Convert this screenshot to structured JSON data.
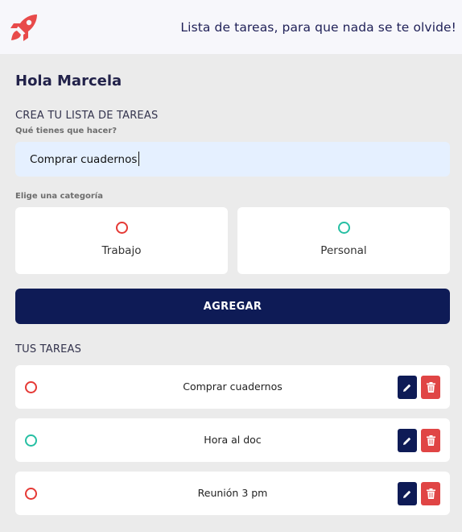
{
  "header": {
    "logo_icon": "rocket-icon",
    "tagline": "Lista de tareas, para que nada se te olvide!"
  },
  "greeting": "Hola Marcela",
  "create": {
    "section_title": "CREA TU LISTA DE TAREAS",
    "input_label": "Qué tienes que hacer?",
    "input_value": "Comprar cuadernos",
    "category_label": "Elige una categoría",
    "categories": [
      {
        "label": "Trabajo",
        "color": "#e53935"
      },
      {
        "label": "Personal",
        "color": "#26bfa3"
      }
    ],
    "add_button": "AGREGAR"
  },
  "tasks": {
    "section_title": "TUS TAREAS",
    "items": [
      {
        "text": "Comprar cuadernos",
        "category": "Trabajo",
        "color": "#e53935"
      },
      {
        "text": "Hora al doc",
        "category": "Personal",
        "color": "#26bfa3"
      },
      {
        "text": "Reunión 3 pm",
        "category": "Trabajo",
        "color": "#e53935"
      }
    ],
    "edit_icon": "pencil-icon",
    "delete_icon": "trash-icon"
  },
  "colors": {
    "primary": "#0e1b56",
    "danger": "#e04545",
    "input_bg": "#e5f0ff",
    "brand": "#e84a4a"
  }
}
